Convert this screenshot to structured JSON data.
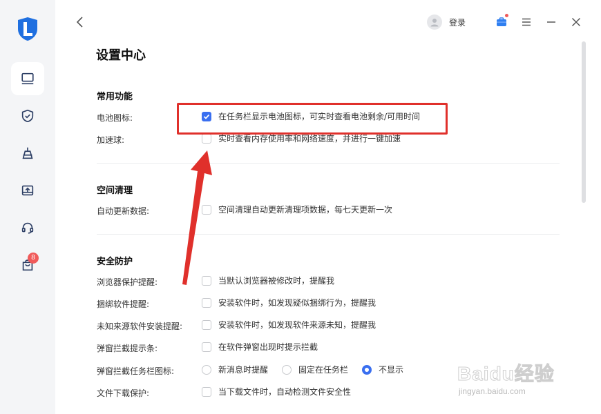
{
  "header": {
    "login_label": "登录"
  },
  "page": {
    "title": "设置中心"
  },
  "sidebar": {
    "badge_count": "8"
  },
  "sections": {
    "common": {
      "title": "常用功能",
      "battery": {
        "label": "电池图标:",
        "option": "在任务栏显示电池图标，可实时查看电池剩余/可用时间",
        "checked": true
      },
      "speedball": {
        "label": "加速球:",
        "option": "实时查看内存使用率和网络速度，并进行一键加速",
        "checked": false
      }
    },
    "cleanup": {
      "title": "空间清理",
      "autoupdate": {
        "label": "自动更新数据:",
        "option": "空间清理自动更新清理项数据，每七天更新一次",
        "checked": false
      }
    },
    "security": {
      "title": "安全防护",
      "browser": {
        "label": "浏览器保护提醒:",
        "option": "当默认浏览器被修改时，提醒我",
        "checked": false
      },
      "bundle": {
        "label": "捆绑软件提醒:",
        "option": "安装软件时，如发现疑似捆绑行为，提醒我",
        "checked": false
      },
      "unknown": {
        "label": "未知来源软件安装提醒:",
        "option": "安装软件时，如发现软件来源未知，提醒我",
        "checked": false
      },
      "popup_bar": {
        "label": "弹窗拦截提示条:",
        "option": "在软件弹窗出现时提示拦截",
        "checked": false
      },
      "popup_icon": {
        "label": "弹窗拦截任务栏图标:",
        "options": [
          "新消息时提醒",
          "固定在任务栏",
          "不显示"
        ],
        "selected": "不显示"
      },
      "download": {
        "label": "文件下载保护:",
        "option": "当下载文件时，自动检测文件安全性",
        "checked": false
      }
    }
  },
  "watermark": {
    "main": "Baidu经验",
    "sub": "jingyan.baidu.com"
  },
  "colors": {
    "accent": "#3a6ff0",
    "annotation": "#e0302b",
    "badge": "#f05a5a"
  }
}
